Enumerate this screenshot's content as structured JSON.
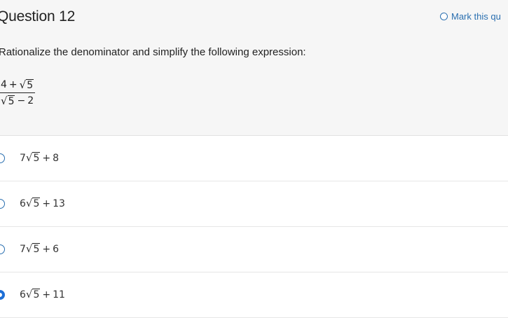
{
  "question": {
    "title": "Question 12",
    "mark_label": "Mark this qu",
    "prompt": "Rationalize the denominator and simplify the following expression:",
    "expression": {
      "num_left": "4",
      "num_op": "+",
      "num_radicand": "5",
      "den_radicand": "5",
      "den_op": "−",
      "den_right": "2"
    }
  },
  "options": [
    {
      "coef": "7",
      "radicand": "5",
      "op": "+",
      "constant": "8",
      "selected": false
    },
    {
      "coef": "6",
      "radicand": "5",
      "op": "+",
      "constant": "13",
      "selected": false
    },
    {
      "coef": "7",
      "radicand": "5",
      "op": "+",
      "constant": "6",
      "selected": false
    },
    {
      "coef": "6",
      "radicand": "5",
      "op": "+",
      "constant": "11",
      "selected": true
    }
  ],
  "colors": {
    "accent": "#2a6fb0",
    "selected": "#1e6fd6",
    "header_bg": "#f6f6f6"
  }
}
